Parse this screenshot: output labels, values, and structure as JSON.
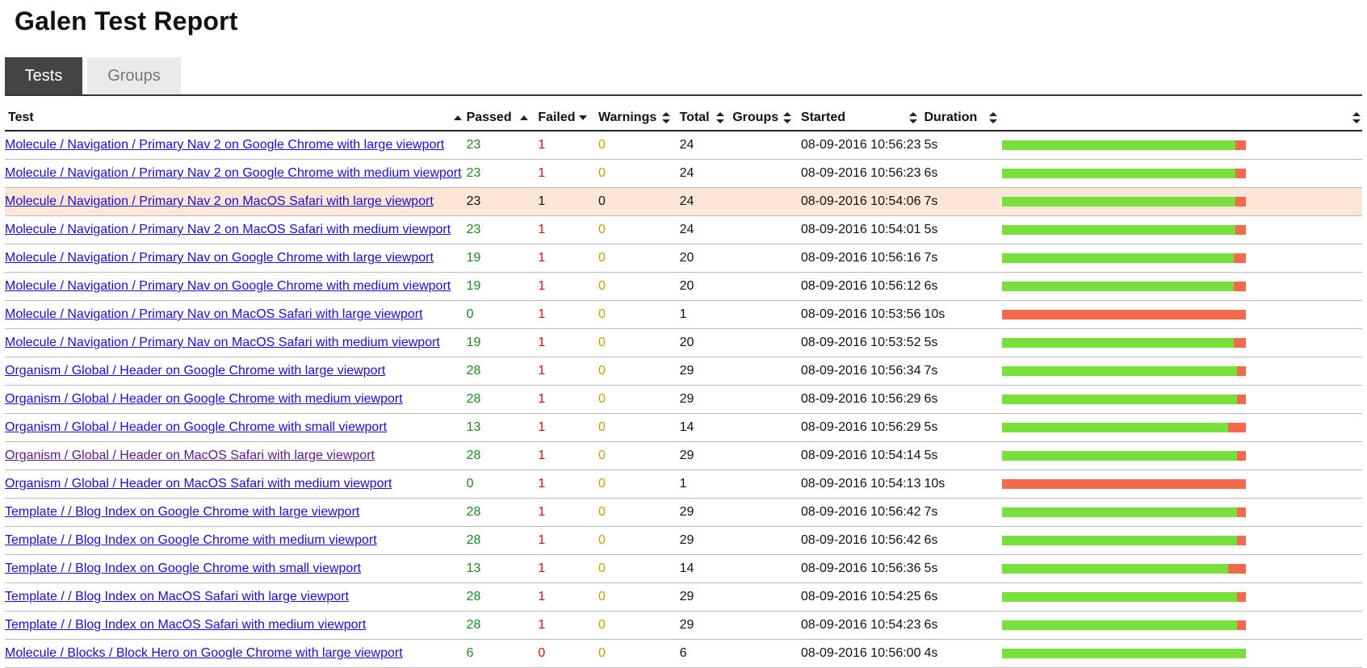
{
  "title": "Galen Test Report",
  "tabs": [
    {
      "label": "Tests",
      "active": true
    },
    {
      "label": "Groups",
      "active": false
    }
  ],
  "columns": {
    "test": "Test",
    "passed": "Passed",
    "failed": "Failed",
    "warnings": "Warnings",
    "total": "Total",
    "groups": "Groups",
    "started": "Started",
    "duration": "Duration"
  },
  "colors": {
    "passed": "#1a8a1a",
    "failed": "#d01010",
    "warnings": "#d09a00",
    "bar_pass": "#77e03a",
    "bar_fail": "#f26a4b",
    "highlight_row": "#fde6d5",
    "link": "#1a0dcc",
    "visited_link": "#551a8b"
  },
  "rows": [
    {
      "test": "Molecule / Navigation / Primary Nav 2 on Google Chrome with large viewport",
      "passed": "23",
      "failed": "1",
      "warnings": "0",
      "total": "24",
      "groups": "",
      "started": "08-09-2016 10:56:23",
      "duration": "5s",
      "pass_fraction": 0.958,
      "highlighted": false,
      "visited": false
    },
    {
      "test": "Molecule / Navigation / Primary Nav 2 on Google Chrome with medium viewport",
      "passed": "23",
      "failed": "1",
      "warnings": "0",
      "total": "24",
      "groups": "",
      "started": "08-09-2016 10:56:23",
      "duration": "6s",
      "pass_fraction": 0.958,
      "highlighted": false,
      "visited": false
    },
    {
      "test": "Molecule / Navigation / Primary Nav 2 on MacOS Safari with large viewport",
      "passed": "23",
      "failed": "1",
      "warnings": "0",
      "total": "24",
      "groups": "",
      "started": "08-09-2016 10:54:06",
      "duration": "7s",
      "pass_fraction": 0.958,
      "highlighted": true,
      "visited": false
    },
    {
      "test": "Molecule / Navigation / Primary Nav 2 on MacOS Safari with medium viewport",
      "passed": "23",
      "failed": "1",
      "warnings": "0",
      "total": "24",
      "groups": "",
      "started": "08-09-2016 10:54:01",
      "duration": "5s",
      "pass_fraction": 0.958,
      "highlighted": false,
      "visited": false
    },
    {
      "test": "Molecule / Navigation / Primary Nav on Google Chrome with large viewport",
      "passed": "19",
      "failed": "1",
      "warnings": "0",
      "total": "20",
      "groups": "",
      "started": "08-09-2016 10:56:16",
      "duration": "7s",
      "pass_fraction": 0.95,
      "highlighted": false,
      "visited": false
    },
    {
      "test": "Molecule / Navigation / Primary Nav on Google Chrome with medium viewport",
      "passed": "19",
      "failed": "1",
      "warnings": "0",
      "total": "20",
      "groups": "",
      "started": "08-09-2016 10:56:12",
      "duration": "6s",
      "pass_fraction": 0.95,
      "highlighted": false,
      "visited": false
    },
    {
      "test": "Molecule / Navigation / Primary Nav on MacOS Safari with large viewport",
      "passed": "0",
      "failed": "1",
      "warnings": "0",
      "total": "1",
      "groups": "",
      "started": "08-09-2016 10:53:56",
      "duration": "10s",
      "pass_fraction": 0,
      "highlighted": false,
      "visited": false
    },
    {
      "test": "Molecule / Navigation / Primary Nav on MacOS Safari with medium viewport",
      "passed": "19",
      "failed": "1",
      "warnings": "0",
      "total": "20",
      "groups": "",
      "started": "08-09-2016 10:53:52",
      "duration": "5s",
      "pass_fraction": 0.95,
      "highlighted": false,
      "visited": false
    },
    {
      "test": "Organism / Global / Header on Google Chrome with large viewport",
      "passed": "28",
      "failed": "1",
      "warnings": "0",
      "total": "29",
      "groups": "",
      "started": "08-09-2016 10:56:34",
      "duration": "7s",
      "pass_fraction": 0.966,
      "highlighted": false,
      "visited": false
    },
    {
      "test": "Organism / Global / Header on Google Chrome with medium viewport",
      "passed": "28",
      "failed": "1",
      "warnings": "0",
      "total": "29",
      "groups": "",
      "started": "08-09-2016 10:56:29",
      "duration": "6s",
      "pass_fraction": 0.966,
      "highlighted": false,
      "visited": false
    },
    {
      "test": "Organism / Global / Header on Google Chrome with small viewport",
      "passed": "13",
      "failed": "1",
      "warnings": "0",
      "total": "14",
      "groups": "",
      "started": "08-09-2016 10:56:29",
      "duration": "5s",
      "pass_fraction": 0.929,
      "highlighted": false,
      "visited": false
    },
    {
      "test": "Organism / Global / Header on MacOS Safari with large viewport",
      "passed": "28",
      "failed": "1",
      "warnings": "0",
      "total": "29",
      "groups": "",
      "started": "08-09-2016 10:54:14",
      "duration": "5s",
      "pass_fraction": 0.966,
      "highlighted": false,
      "visited": true
    },
    {
      "test": "Organism / Global / Header on MacOS Safari with medium viewport",
      "passed": "0",
      "failed": "1",
      "warnings": "0",
      "total": "1",
      "groups": "",
      "started": "08-09-2016 10:54:13",
      "duration": "10s",
      "pass_fraction": 0,
      "highlighted": false,
      "visited": false
    },
    {
      "test": "Template / / Blog Index on Google Chrome with large viewport",
      "passed": "28",
      "failed": "1",
      "warnings": "0",
      "total": "29",
      "groups": "",
      "started": "08-09-2016 10:56:42",
      "duration": "7s",
      "pass_fraction": 0.966,
      "highlighted": false,
      "visited": false
    },
    {
      "test": "Template / / Blog Index on Google Chrome with medium viewport",
      "passed": "28",
      "failed": "1",
      "warnings": "0",
      "total": "29",
      "groups": "",
      "started": "08-09-2016 10:56:42",
      "duration": "6s",
      "pass_fraction": 0.966,
      "highlighted": false,
      "visited": false
    },
    {
      "test": "Template / / Blog Index on Google Chrome with small viewport",
      "passed": "13",
      "failed": "1",
      "warnings": "0",
      "total": "14",
      "groups": "",
      "started": "08-09-2016 10:56:36",
      "duration": "5s",
      "pass_fraction": 0.929,
      "highlighted": false,
      "visited": false
    },
    {
      "test": "Template / / Blog Index on MacOS Safari with large viewport",
      "passed": "28",
      "failed": "1",
      "warnings": "0",
      "total": "29",
      "groups": "",
      "started": "08-09-2016 10:54:25",
      "duration": "6s",
      "pass_fraction": 0.966,
      "highlighted": false,
      "visited": false
    },
    {
      "test": "Template / / Blog Index on MacOS Safari with medium viewport",
      "passed": "28",
      "failed": "1",
      "warnings": "0",
      "total": "29",
      "groups": "",
      "started": "08-09-2016 10:54:23",
      "duration": "6s",
      "pass_fraction": 0.966,
      "highlighted": false,
      "visited": false
    },
    {
      "test": "Molecule / Blocks / Block Hero on Google Chrome with large viewport",
      "passed": "6",
      "failed": "0",
      "warnings": "0",
      "total": "6",
      "groups": "",
      "started": "08-09-2016 10:56:00",
      "duration": "4s",
      "pass_fraction": 1,
      "highlighted": false,
      "visited": false
    }
  ]
}
